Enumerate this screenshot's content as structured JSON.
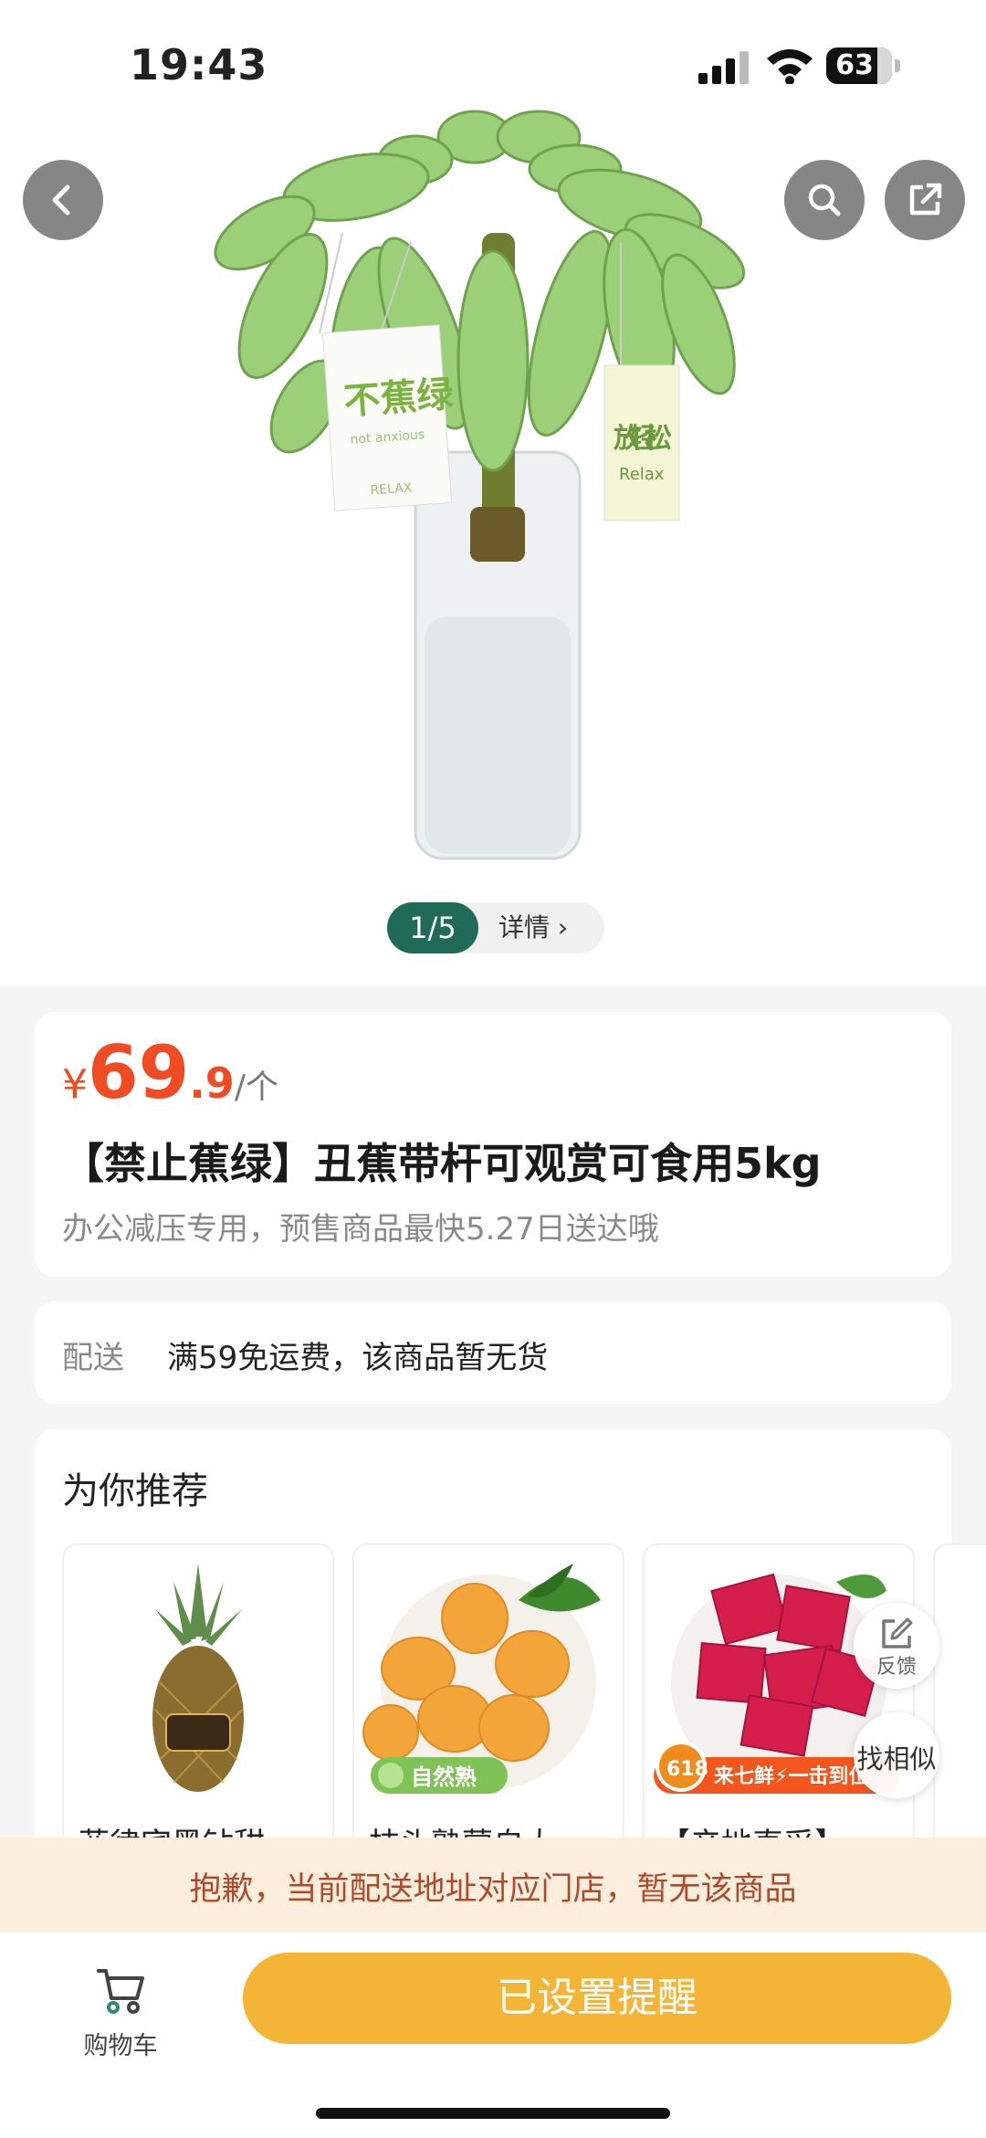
{
  "status_bar": {
    "time": "19:43",
    "battery": "63"
  },
  "header": {
    "back_icon": "chevron-left-icon",
    "search_icon": "search-icon",
    "share_icon": "share-icon"
  },
  "product_image": {
    "tag_left_big": "不蕉绿",
    "tag_left_small": "not anxious",
    "tag_left_bottom": "RELAX",
    "tag_right_cn": "放轻松",
    "tag_right_en": "Relax"
  },
  "gallery": {
    "index": "1/5",
    "detail_label": "详情 ›"
  },
  "price": {
    "currency": "¥",
    "integer": "69",
    "decimal": ".9",
    "unit": "/个",
    "color": "#f04b23"
  },
  "product": {
    "title": "【禁止蕉绿】丑蕉带杆可观赏可食用5kg",
    "subtitle": "办公减压专用，预售商品最快5.27日送达哦"
  },
  "delivery": {
    "label": "配送",
    "value": "满59免运费，该商品暂无货"
  },
  "recommend": {
    "title": "为你推荐",
    "items": [
      {
        "name": "菲律宾黑钻甜",
        "image": "pineapple"
      },
      {
        "name": "枝头熟蒙自大",
        "image": "loquat",
        "badge": "自然熟"
      },
      {
        "name": "【产地直采】",
        "image": "dragon-fruit",
        "badge_618": "618",
        "badge_text": "来七鲜⚡一击到位"
      }
    ]
  },
  "floating": {
    "feedback": "反馈",
    "similar": "找相似"
  },
  "notice": "抱歉，当前配送地址对应门店，暂无该商品",
  "bottom": {
    "cart_label": "购物车",
    "remind_button": "已设置提醒",
    "accent": "#f4b536"
  }
}
